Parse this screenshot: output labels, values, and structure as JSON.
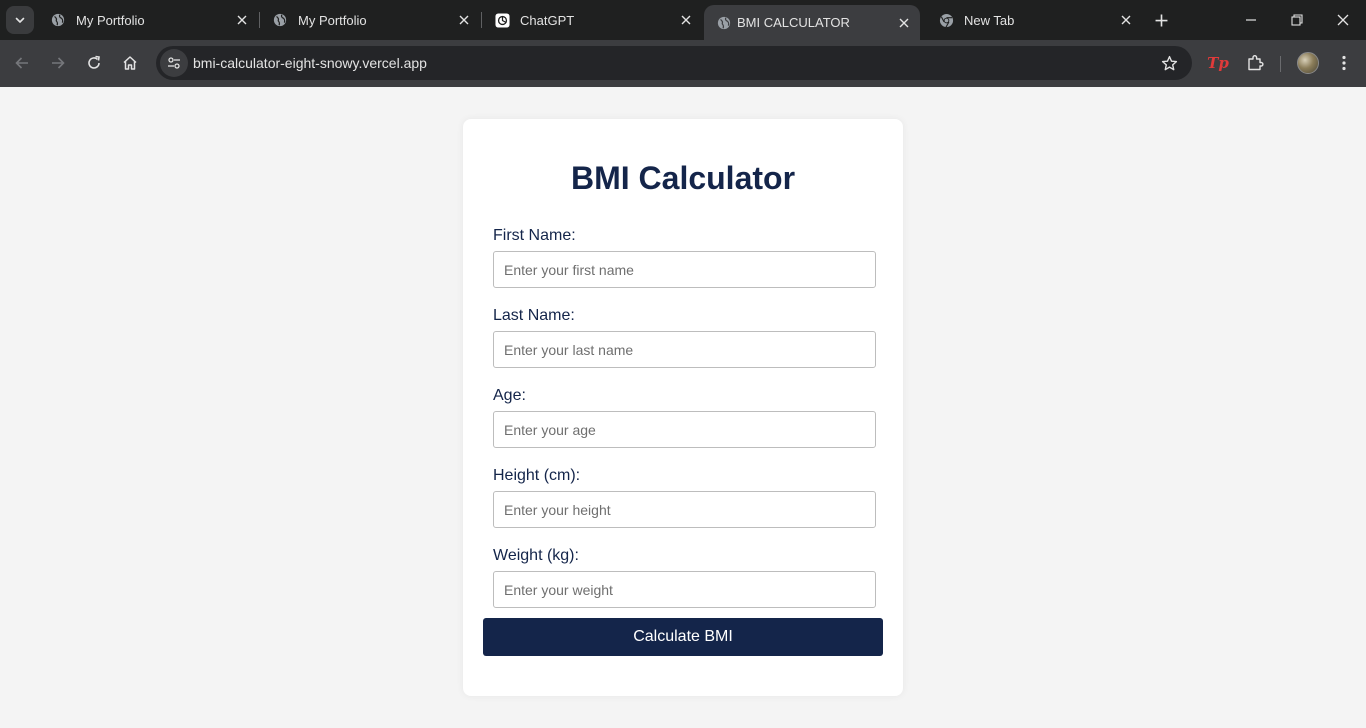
{
  "browser": {
    "tabs": [
      {
        "title": "My Portfolio",
        "icon": "globe-icon",
        "active": false
      },
      {
        "title": "My Portfolio",
        "icon": "globe-icon",
        "active": false
      },
      {
        "title": "ChatGPT",
        "icon": "chatgpt-icon",
        "active": false
      },
      {
        "title": "BMI CALCULATOR",
        "icon": "globe-icon",
        "active": true
      },
      {
        "title": "New Tab",
        "icon": "chrome-icon",
        "active": false
      }
    ],
    "url": "bmi-calculator-eight-snowy.vercel.app",
    "extension_label": "Tp"
  },
  "form": {
    "title": "BMI Calculator",
    "fields": [
      {
        "label": "First Name:",
        "placeholder": "Enter your first name",
        "value": ""
      },
      {
        "label": "Last Name:",
        "placeholder": "Enter your last name",
        "value": ""
      },
      {
        "label": "Age:",
        "placeholder": "Enter your age",
        "value": ""
      },
      {
        "label": "Height (cm):",
        "placeholder": "Enter your height",
        "value": ""
      },
      {
        "label": "Weight (kg):",
        "placeholder": "Enter your weight",
        "value": ""
      }
    ],
    "button_label": "Calculate BMI"
  },
  "colors": {
    "primary": "#14254a",
    "page_background": "#f4f4f4",
    "card_background": "#ffffff",
    "chrome_dark": "#1f2020",
    "chrome_toolbar": "#3c3d40"
  }
}
